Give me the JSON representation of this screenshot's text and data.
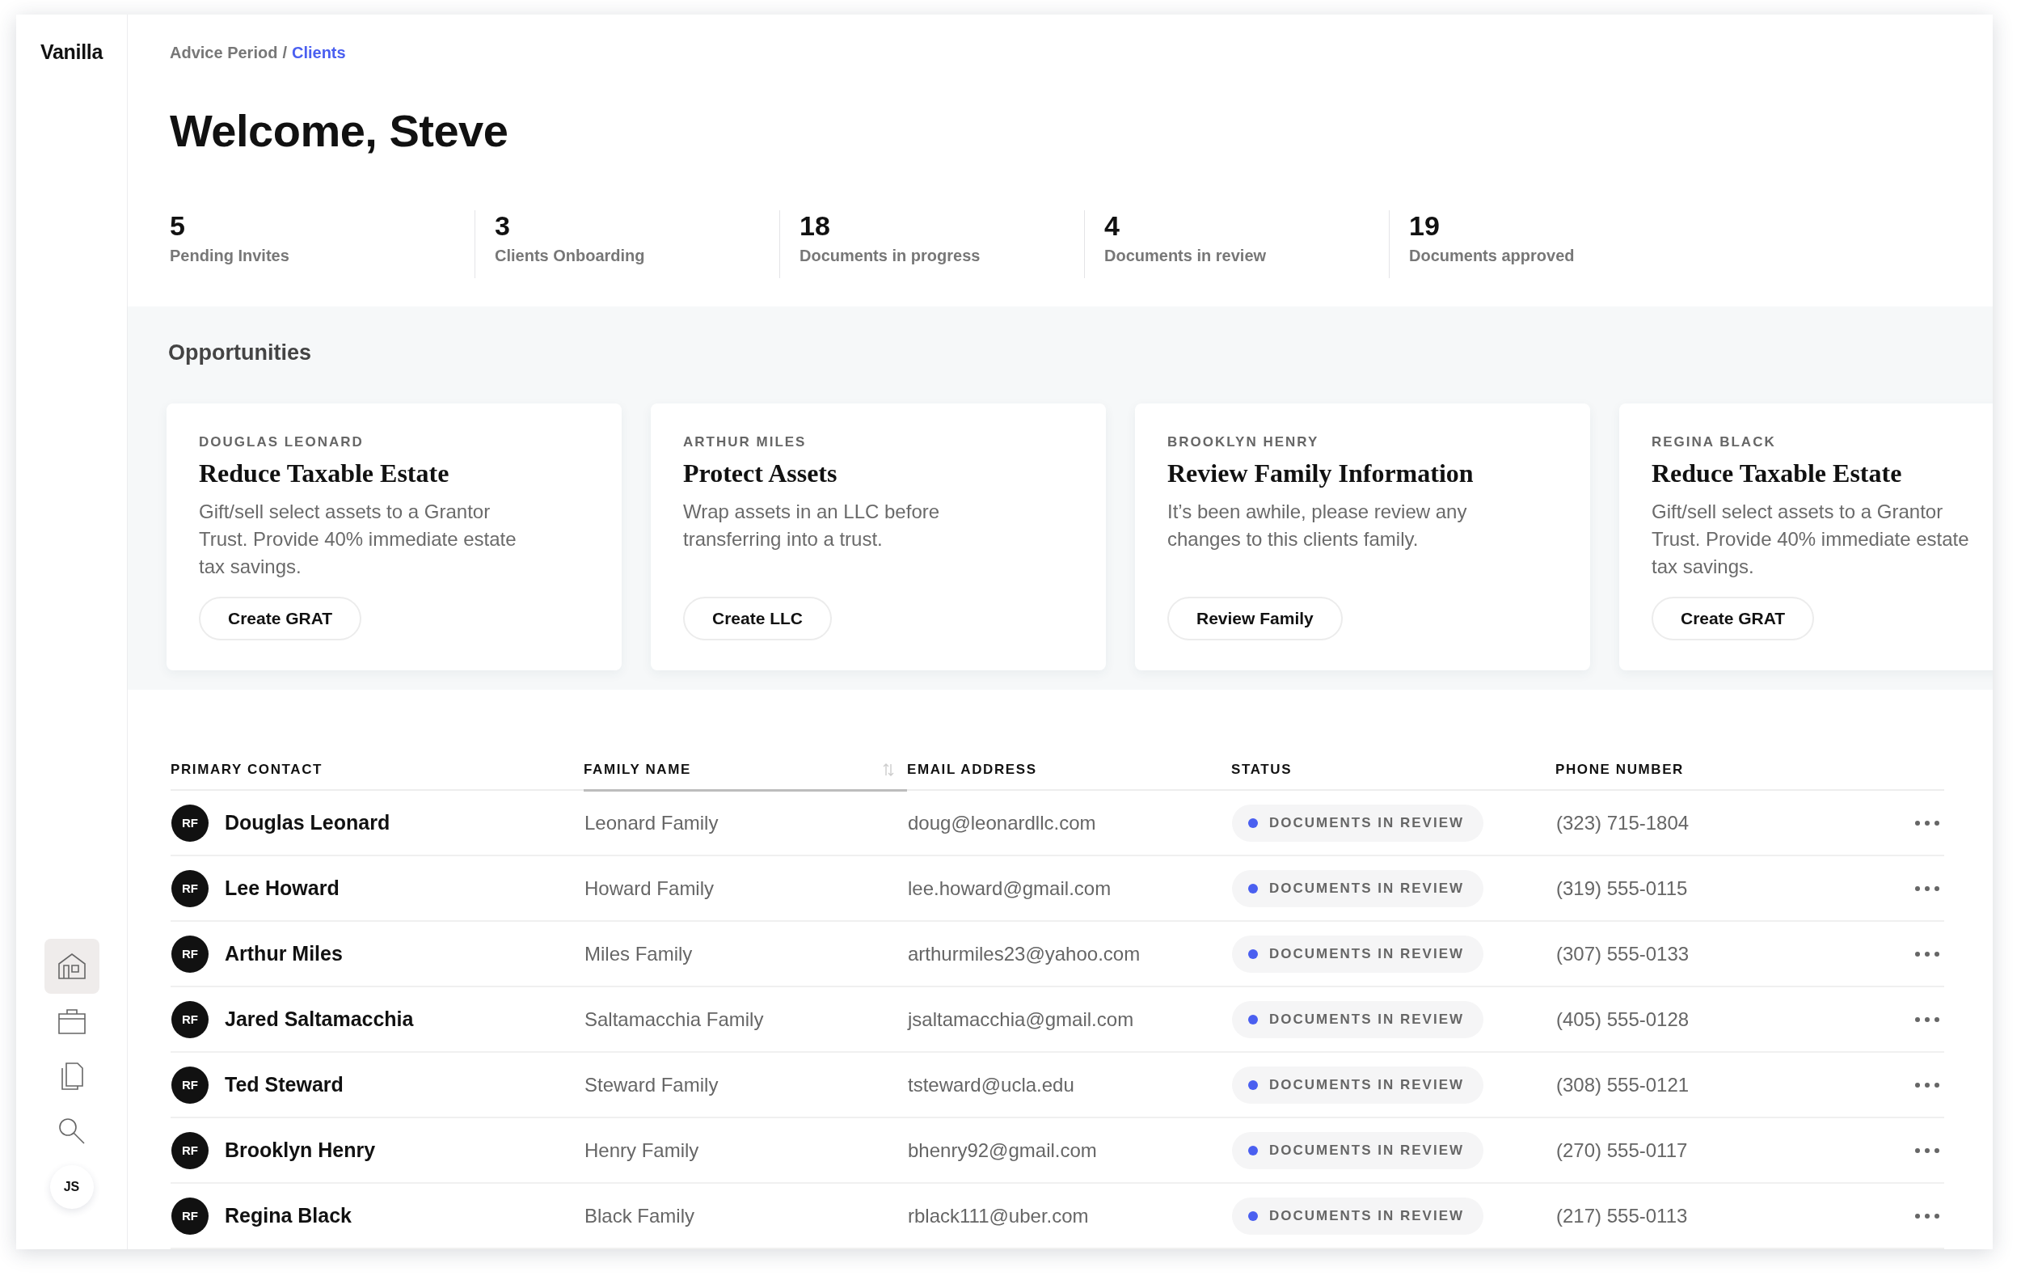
{
  "sidebar": {
    "logo": "Vanilla",
    "nav": [
      {
        "kind": "home",
        "selected": true
      },
      {
        "kind": "briefcase",
        "selected": false
      },
      {
        "kind": "documents",
        "selected": false
      },
      {
        "kind": "search",
        "selected": false
      }
    ],
    "user": "JS"
  },
  "breadcrumb": {
    "separator": "/",
    "items": [
      {
        "label": "Advice Period",
        "current": false
      },
      {
        "label": "Clients",
        "current": true
      }
    ]
  },
  "title": "Welcome, Steve",
  "stats": [
    {
      "value": "5",
      "label": "Pending Invites"
    },
    {
      "value": "3",
      "label": "Clients Onboarding"
    },
    {
      "value": "18",
      "label": "Documents in progress"
    },
    {
      "value": "4",
      "label": "Documents in review"
    },
    {
      "value": "19",
      "label": "Documents approved"
    }
  ],
  "opportunities": {
    "heading": "Opportunities",
    "cards": [
      {
        "client": "DOUGLAS LEONARD",
        "title": "Reduce Taxable Estate",
        "text": "Gift/sell select assets to a Grantor Trust. Provide 40% immediate estate tax savings.",
        "action": "Create GRAT"
      },
      {
        "client": "ARTHUR MILES",
        "title": "Protect Assets",
        "text": "Wrap assets in an LLC before transferring into a trust.",
        "action": "Create LLC"
      },
      {
        "client": "BROOKLYN HENRY",
        "title": "Review Family Information",
        "text": "It’s been awhile, please review any changes to this clients family.",
        "action": "Review Family"
      },
      {
        "client": "REGINA BLACK",
        "title": "Reduce Taxable Estate",
        "text": "Gift/sell select assets to a Grantor Trust. Provide 40% immediate estate tax savings.",
        "action": "Create GRAT"
      }
    ]
  },
  "table": {
    "columns": [
      {
        "label": "PRIMARY CONTACT",
        "sorted": false
      },
      {
        "label": "FAMILY NAME",
        "sorted": true
      },
      {
        "label": "EMAIL ADDRESS",
        "sorted": false
      },
      {
        "label": "STATUS",
        "sorted": false
      },
      {
        "label": "PHONE NUMBER",
        "sorted": false
      }
    ],
    "rows": [
      {
        "initials": "RF",
        "contact": "Douglas Leonard",
        "family": "Leonard Family",
        "email": "doug@leonardllc.com",
        "status": "DOCUMENTS IN REVIEW",
        "phone": "(323) 715-1804"
      },
      {
        "initials": "RF",
        "contact": "Lee Howard",
        "family": "Howard Family",
        "email": "lee.howard@gmail.com",
        "status": "DOCUMENTS IN REVIEW",
        "phone": "(319) 555-0115"
      },
      {
        "initials": "RF",
        "contact": "Arthur Miles",
        "family": "Miles Family",
        "email": "arthurmiles23@yahoo.com",
        "status": "DOCUMENTS IN REVIEW",
        "phone": "(307) 555-0133"
      },
      {
        "initials": "RF",
        "contact": "Jared Saltamacchia",
        "family": "Saltamacchia Family",
        "email": "jsaltamacchia@gmail.com",
        "status": "DOCUMENTS IN REVIEW",
        "phone": "(405) 555-0128"
      },
      {
        "initials": "RF",
        "contact": "Ted Steward",
        "family": "Steward Family",
        "email": "tsteward@ucla.edu",
        "status": "DOCUMENTS IN REVIEW",
        "phone": "(308) 555-0121"
      },
      {
        "initials": "RF",
        "contact": "Brooklyn Henry",
        "family": "Henry Family",
        "email": "bhenry92@gmail.com",
        "status": "DOCUMENTS IN REVIEW",
        "phone": "(270) 555-0117"
      },
      {
        "initials": "RF",
        "contact": "Regina Black",
        "family": "Black Family",
        "email": "rblack111@uber.com",
        "status": "DOCUMENTS IN REVIEW",
        "phone": "(217) 555-0113"
      }
    ]
  }
}
